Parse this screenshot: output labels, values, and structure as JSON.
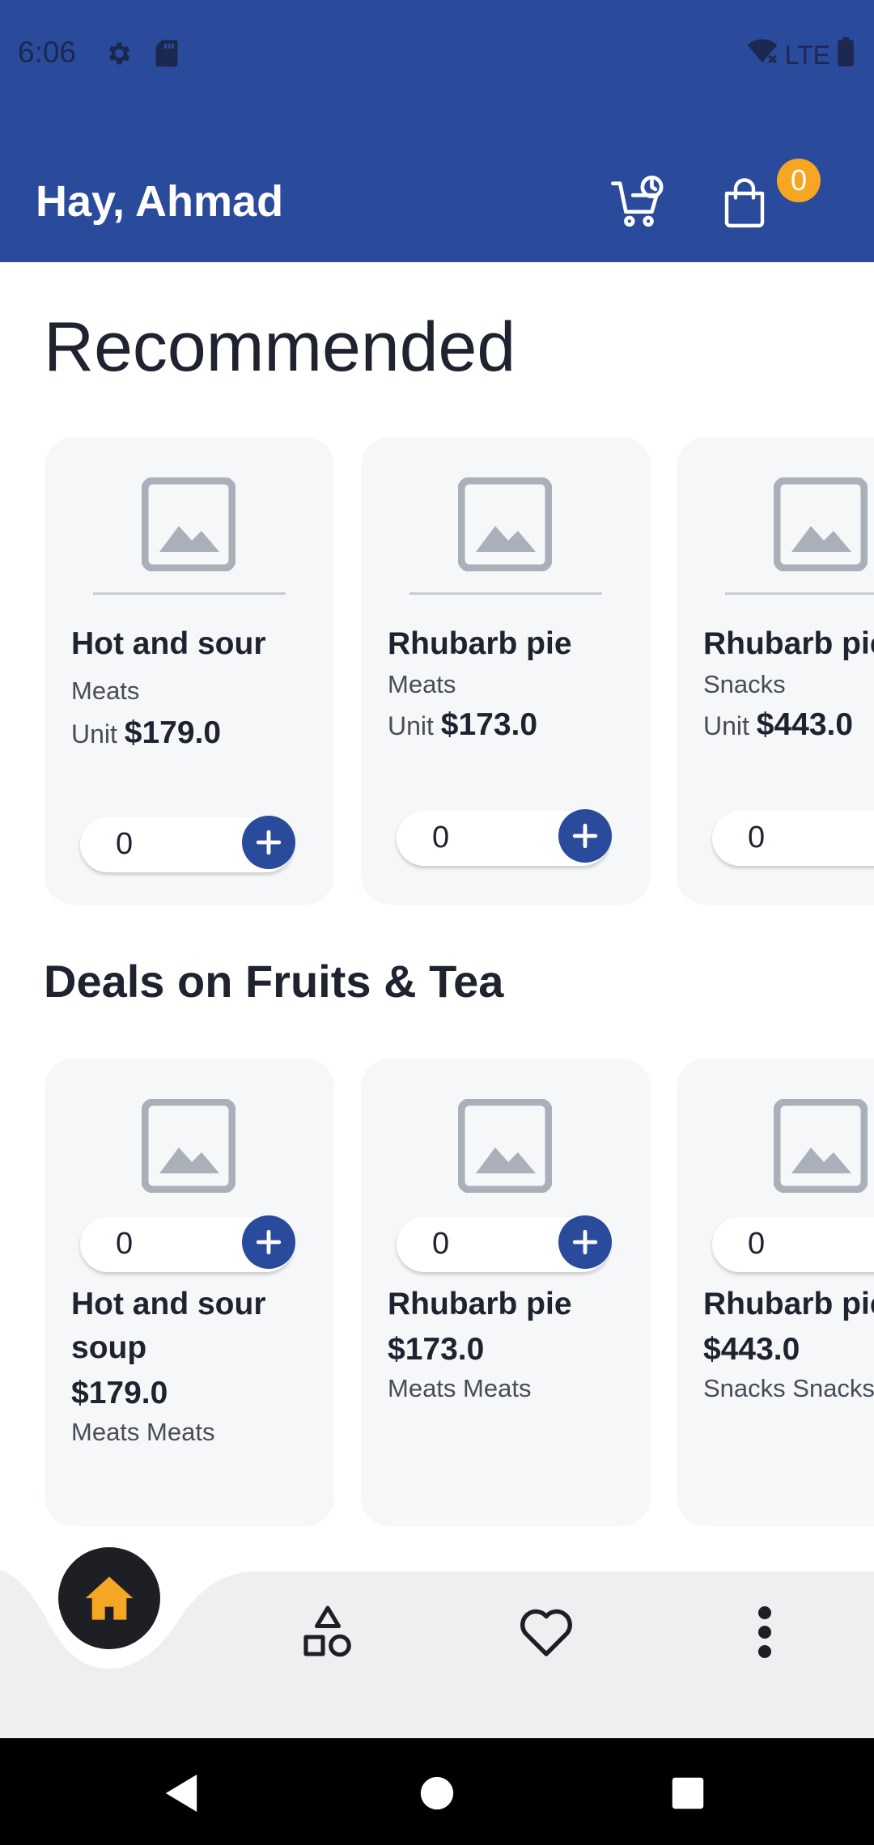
{
  "status_bar": {
    "time": "6:06",
    "network": "LTE"
  },
  "header": {
    "greeting": "Hay, Ahmad",
    "bag_badge": "0"
  },
  "recommended": {
    "title": "Recommended",
    "items": [
      {
        "name": "Hot and sour",
        "category": "Meats",
        "unit_label": "Unit",
        "price": "$179.0",
        "qty": "0"
      },
      {
        "name": "Rhubarb pie",
        "category": "Meats",
        "unit_label": "Unit",
        "price": "$173.0",
        "qty": "0"
      },
      {
        "name": "Rhubarb pie",
        "category": "Snacks",
        "unit_label": "Unit",
        "price": "$443.0",
        "qty": "0"
      }
    ]
  },
  "deals": {
    "title": "Deals on Fruits & Tea",
    "items": [
      {
        "name_line1": "Hot and sour",
        "name_line2": "soup",
        "price": "$179.0",
        "category": "Meats Meats",
        "qty": "0"
      },
      {
        "name_line1": "Rhubarb pie",
        "name_line2": "",
        "price": "$173.0",
        "category": "Meats Meats",
        "qty": "0"
      },
      {
        "name_line1": "Rhubarb pie",
        "name_line2": "",
        "price": "$443.0",
        "category": "Snacks Snacks",
        "qty": "0"
      }
    ]
  },
  "nav": {
    "items": [
      "home-icon",
      "categories-icon",
      "favorites-icon",
      "more-icon"
    ],
    "active_color": "#f5a623"
  },
  "colors": {
    "primary": "#2a4b9b",
    "accent": "#f5a623",
    "card_bg": "#f6f7f9",
    "nav_bg": "#eeeff1"
  }
}
